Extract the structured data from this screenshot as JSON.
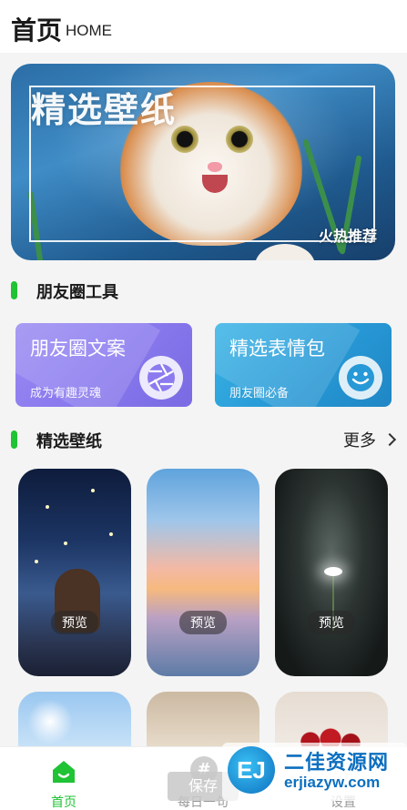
{
  "header": {
    "title": "首页",
    "subtitle": "HOME"
  },
  "banner": {
    "title": "精选壁纸",
    "tag": "火热推荐"
  },
  "sections": {
    "tools": "朋友圈工具",
    "wallpapers": "精选壁纸",
    "more": "更多"
  },
  "tools": [
    {
      "name": "朋友圈文案",
      "sub": "成为有趣灵魂",
      "icon": "aperture-icon",
      "color": "#8b7bef"
    },
    {
      "name": "精选表情包",
      "sub": "朋友圈必备",
      "icon": "smiley-icon",
      "color": "#2799d6"
    }
  ],
  "wallpaper_preview_label": "预览",
  "save_label": "保存",
  "tabs": [
    {
      "label": "首页",
      "icon": "home-icon",
      "active": true
    },
    {
      "label": "每日一句",
      "icon": "hash-icon",
      "active": false
    },
    {
      "label": "设置",
      "icon": "settings-icon",
      "active": false
    }
  ],
  "watermark": {
    "cn": "二佳资源网",
    "en": "erjiazyw.com",
    "logo": "EJ"
  },
  "colors": {
    "accent": "#1fc334",
    "tool1": "#8b7bef",
    "tool2": "#2799d6",
    "watermark": "#0d6fbf"
  }
}
